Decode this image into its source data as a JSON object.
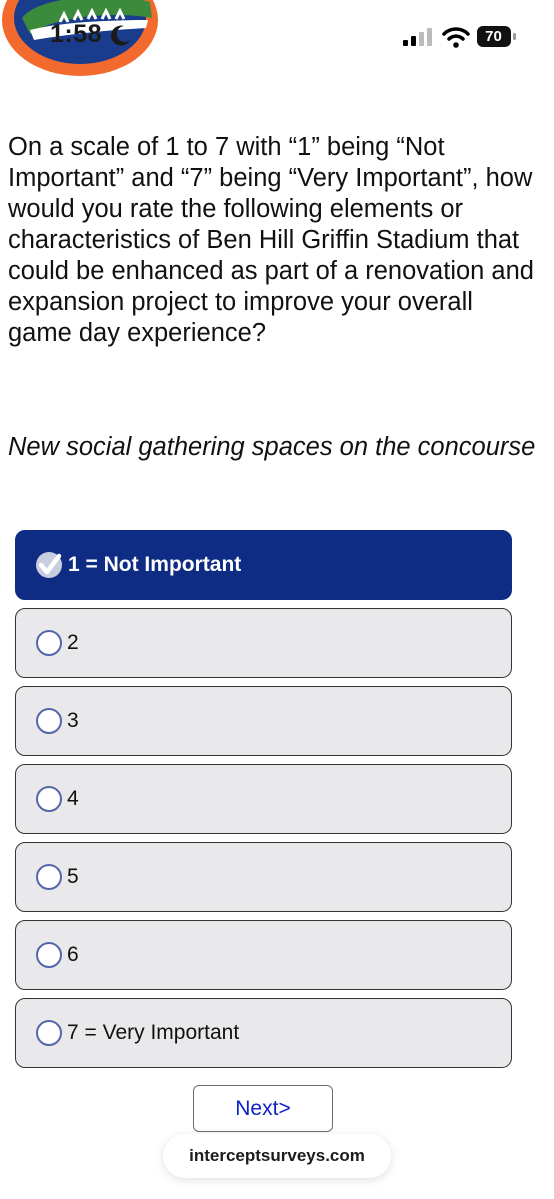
{
  "status_bar": {
    "time": "1:58",
    "battery": "70",
    "icons": [
      "gator-logo",
      "moon-icon",
      "signal-icon",
      "wifi-icon",
      "battery-icon"
    ]
  },
  "survey": {
    "question": "On a scale of 1 to 7 with “1” being “Not Important” and “7” being “Very Important”, how would you rate the following elements or characteristics of Ben Hill Griffin Stadium that could be enhanced as part of a renovation and expansion project to improve your overall game day experience?",
    "item": "New social gathering spaces on the concourse",
    "options": [
      {
        "label": "1 = Not Important",
        "selected": true
      },
      {
        "label": "2",
        "selected": false
      },
      {
        "label": "3",
        "selected": false
      },
      {
        "label": "4",
        "selected": false
      },
      {
        "label": "5",
        "selected": false
      },
      {
        "label": "6",
        "selected": false
      },
      {
        "label": "7 = Very Important",
        "selected": false
      }
    ],
    "next_label": "Next>"
  },
  "browser": {
    "url": "interceptsurveys.com"
  },
  "colors": {
    "selected_bg": "#0f2c84",
    "option_bg": "#e9e8ea",
    "link_blue": "#1020c8",
    "gator_orange": "#f26a2e",
    "gator_blue": "#1a3c8c",
    "gator_green": "#3c8a3c"
  }
}
